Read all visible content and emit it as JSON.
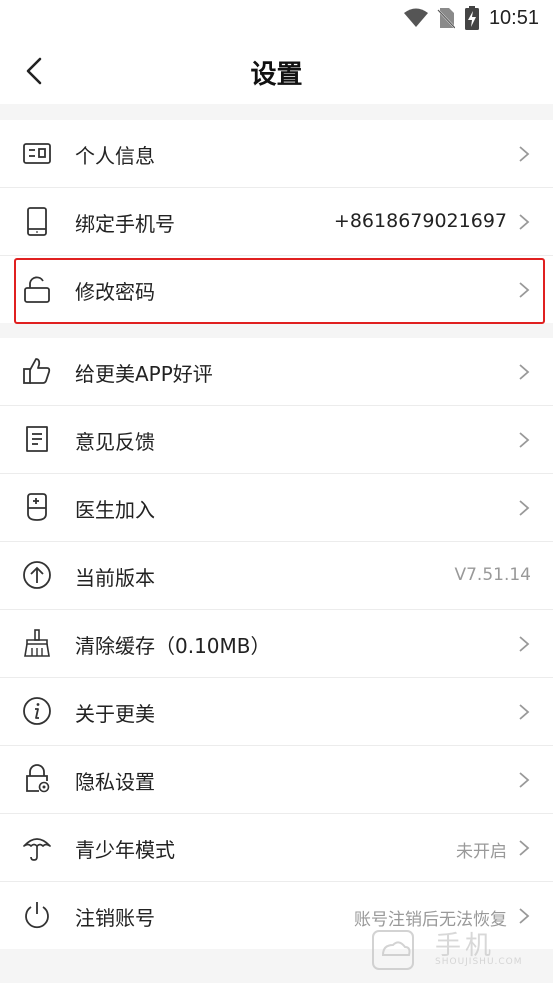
{
  "status_bar": {
    "time": "10:51"
  },
  "header": {
    "title": "设置"
  },
  "account_group": [
    {
      "name": "personal-info",
      "label": "个人信息",
      "value": ""
    },
    {
      "name": "bind-phone",
      "label": "绑定手机号",
      "value": "+8618679021697"
    },
    {
      "name": "change-password",
      "label": "修改密码",
      "value": ""
    }
  ],
  "app_group": [
    {
      "label": "给更美APP好评"
    },
    {
      "label": "意见反馈"
    },
    {
      "label": "医生加入"
    },
    {
      "label": "当前版本",
      "value": "V7.51.14"
    },
    {
      "label": "清除缓存（0.10MB）"
    },
    {
      "label": "关于更美"
    },
    {
      "label": "隐私设置"
    },
    {
      "label": "青少年模式",
      "value": "未开启"
    },
    {
      "label": "注销账号",
      "value": "账号注销后无法恢复"
    }
  ],
  "watermark": {
    "cn": "手机",
    "en": "SHOUJISHU.COM"
  },
  "colors": {
    "highlight": "#e02020",
    "divider": "#ececec",
    "muted_text": "#999999"
  }
}
